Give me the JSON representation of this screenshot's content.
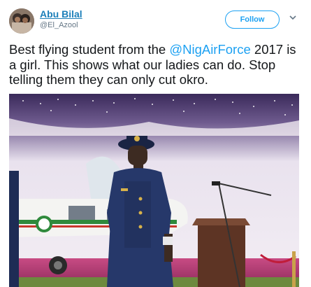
{
  "tweet": {
    "author_name": "Abu Bilal",
    "author_handle": "@El_Azool",
    "follow_label": "Follow",
    "text_before": "Best flying student from the ",
    "mention": "@NigAirForce",
    "text_after": " 2017 is a girl.  This shows what our ladies can do. Stop telling them they can only cut okro."
  },
  "icons": {
    "menu": "chevron-down-icon"
  },
  "colors": {
    "link": "#1da1f2",
    "name": "#1c7fb9",
    "handle": "#657786",
    "uniform": "#1f2f57"
  }
}
